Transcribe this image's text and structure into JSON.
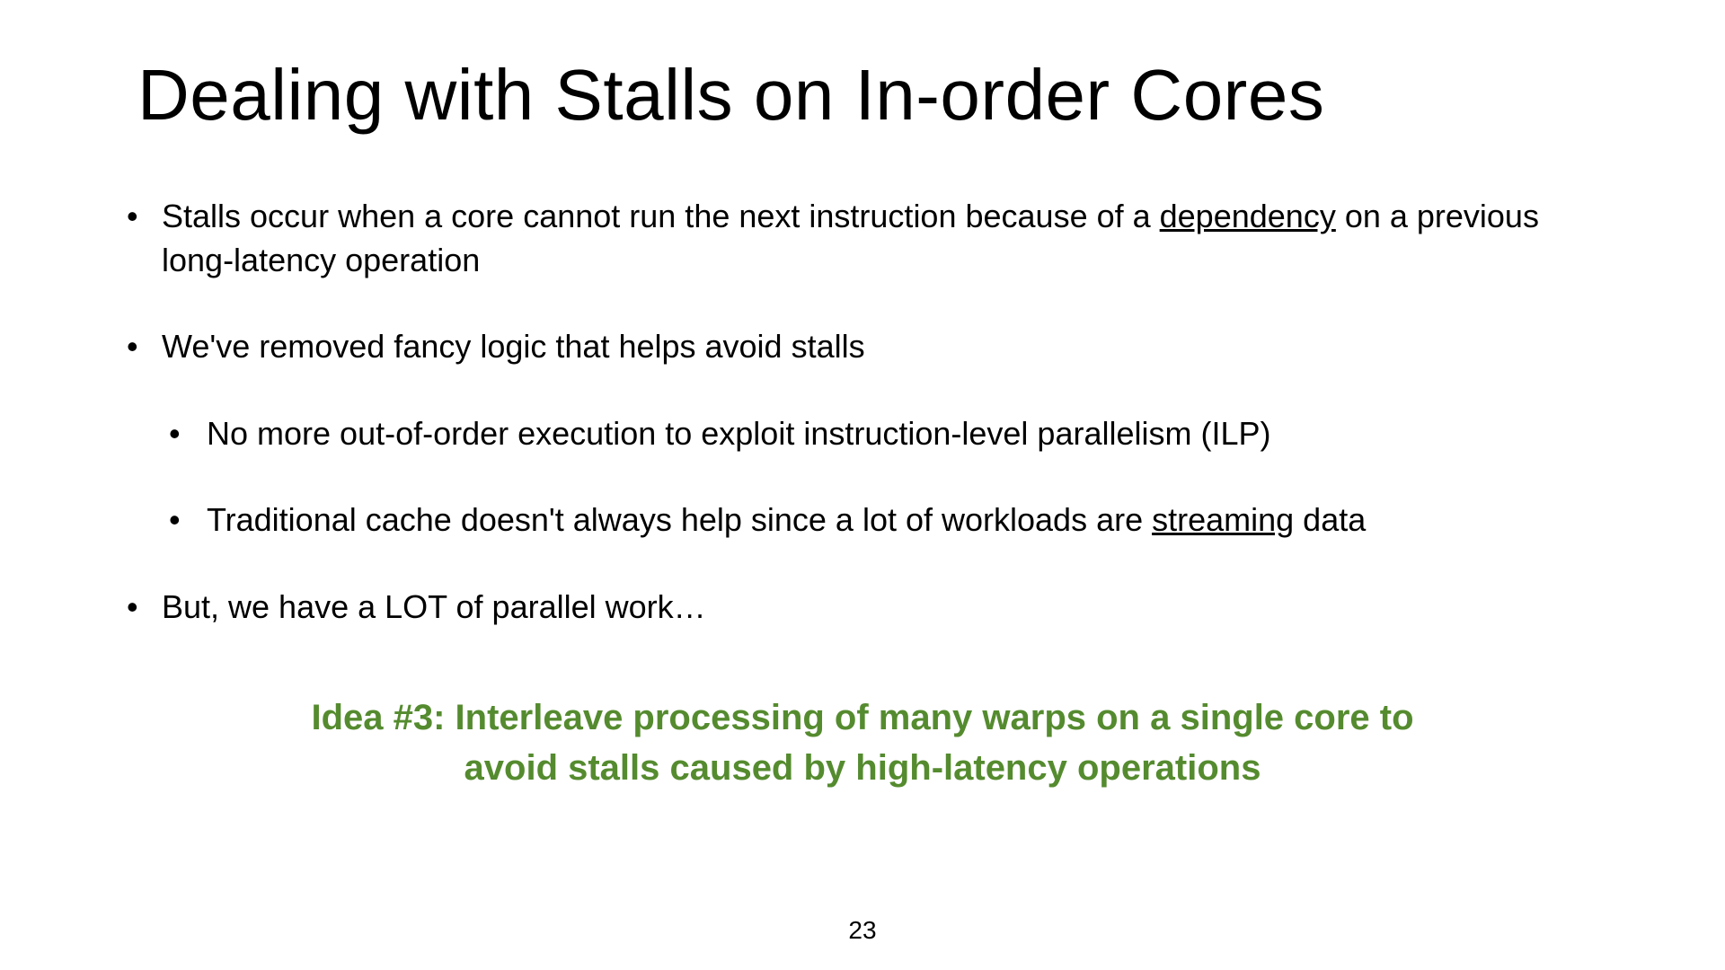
{
  "slide": {
    "title": "Dealing with Stalls on In-order Cores",
    "bullets": {
      "b1_pre": "Stalls occur when a core cannot run the next instruction because of a ",
      "b1_underline": "dependency",
      "b1_post": " on a previous long-latency operation",
      "b2": "We've removed fancy logic that helps avoid stalls",
      "b2_sub1": "No more out-of-order execution to exploit instruction-level parallelism (ILP)",
      "b2_sub2_pre": "Traditional cache doesn't always help since a lot of workloads are ",
      "b2_sub2_underline": "streaming",
      "b2_sub2_post": " data",
      "b3": "But, we have a LOT of parallel work…"
    },
    "idea_line1": "Idea #3: Interleave processing of many warps on a single core to",
    "idea_line2": "avoid stalls caused by high-latency operations",
    "page_number": "23"
  }
}
